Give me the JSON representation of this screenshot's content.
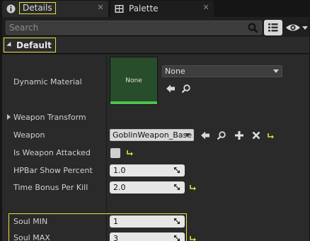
{
  "tabs": [
    {
      "label": "Details",
      "icon": "info-icon",
      "active": true
    },
    {
      "label": "Palette",
      "icon": "palette-grid-icon",
      "active": false
    }
  ],
  "search": {
    "placeholder": "Search"
  },
  "category": {
    "label": "Default"
  },
  "properties": {
    "dynamic_material": {
      "label": "Dynamic Material",
      "thumbnail_label": "None",
      "value": "None"
    },
    "weapon_transform": {
      "label": "Weapon Transform"
    },
    "weapon": {
      "label": "Weapon",
      "value": "GoblinWeapon_Base"
    },
    "is_weapon_attacked": {
      "label": "Is Weapon Attacked",
      "checked": false
    },
    "hpbar_show_percent": {
      "label": "HPBar Show Percent",
      "value": "1.0"
    },
    "time_bonus_per_kill": {
      "label": "Time Bonus Per Kill",
      "value": "2.0"
    },
    "soul_min": {
      "label": "Soul MIN",
      "value": "1"
    },
    "soul_max": {
      "label": "Soul MAX",
      "value": "3"
    }
  },
  "colors": {
    "highlight": "#e6df3c",
    "reset_arrow": "#e6df3c",
    "material_thumb": "#284d2a"
  }
}
